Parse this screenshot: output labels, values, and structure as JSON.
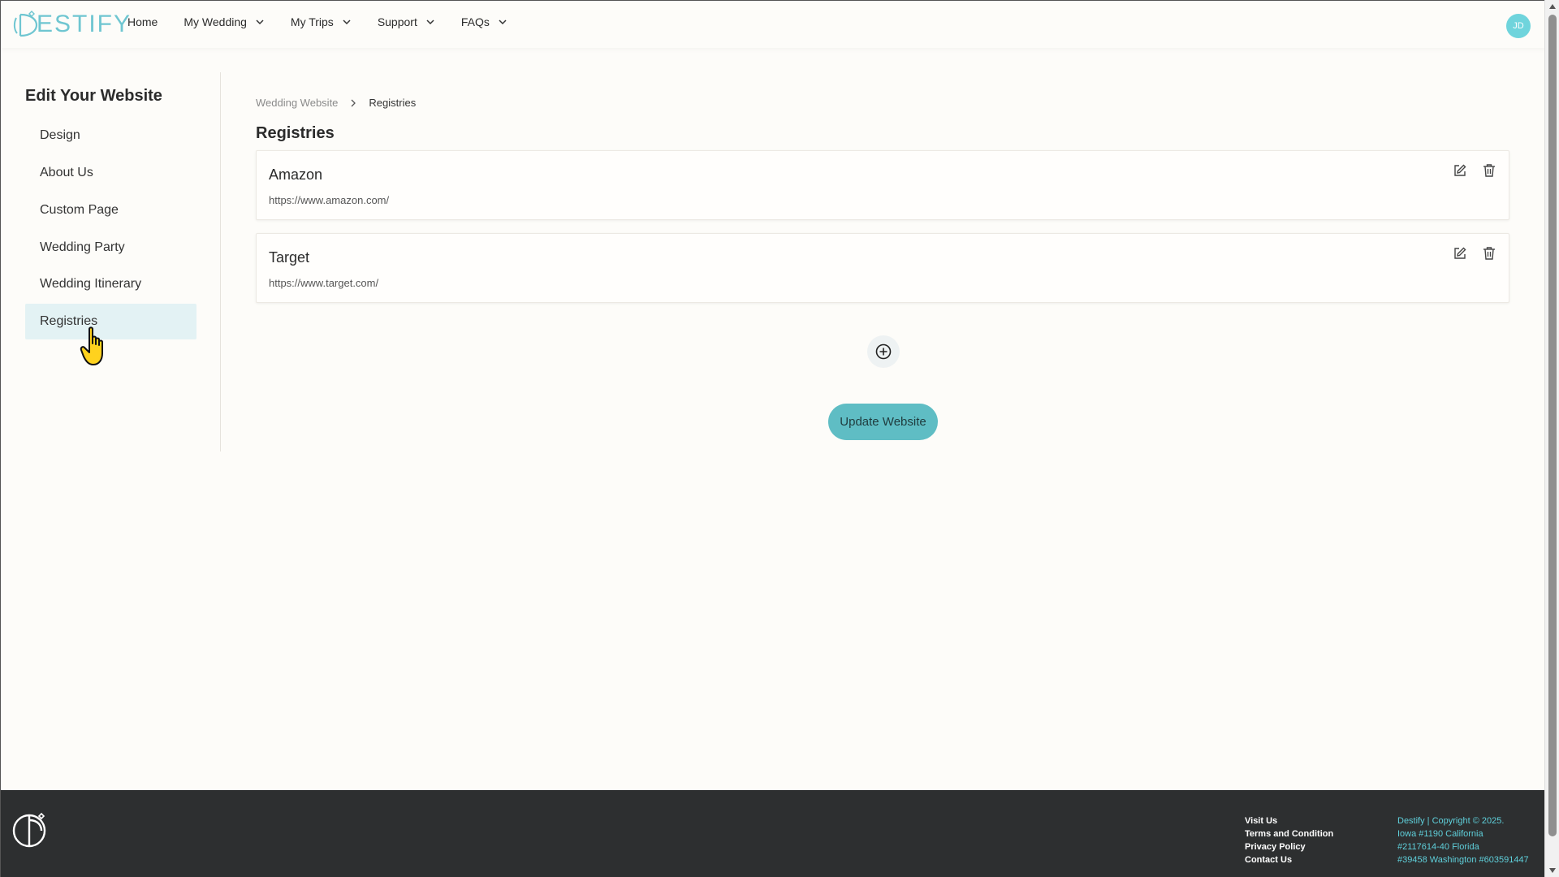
{
  "brand": {
    "logo_text": "ESTIFY",
    "accent": "#5fbdc4"
  },
  "nav": {
    "items": [
      {
        "label": "Home",
        "dropdown": false
      },
      {
        "label": "My Wedding",
        "dropdown": true
      },
      {
        "label": "My Trips",
        "dropdown": true
      },
      {
        "label": "Support",
        "dropdown": true
      },
      {
        "label": "FAQs",
        "dropdown": true
      }
    ],
    "avatar_initials": "JD"
  },
  "sidebar": {
    "title": "Edit Your Website",
    "items": [
      {
        "label": "Design"
      },
      {
        "label": "About Us"
      },
      {
        "label": "Custom Page"
      },
      {
        "label": "Wedding Party"
      },
      {
        "label": "Wedding Itinerary"
      },
      {
        "label": "Registries",
        "active": true
      }
    ]
  },
  "main": {
    "breadcrumb": {
      "parent": "Wedding Website",
      "current": "Registries"
    },
    "title": "Registries",
    "registries": [
      {
        "name": "Amazon",
        "url": "https://www.amazon.com/"
      },
      {
        "name": "Target",
        "url": "https://www.target.com/"
      }
    ],
    "update_label": "Update Website"
  },
  "footer": {
    "links": [
      "Visit Us",
      "Terms and Condition",
      "Privacy Policy",
      "Contact Us"
    ],
    "info": [
      "Destify | Copyright © 2025.",
      "Iowa #1190 California",
      "#2117614-40 Florida",
      "#39458 Washington #603591447"
    ]
  }
}
